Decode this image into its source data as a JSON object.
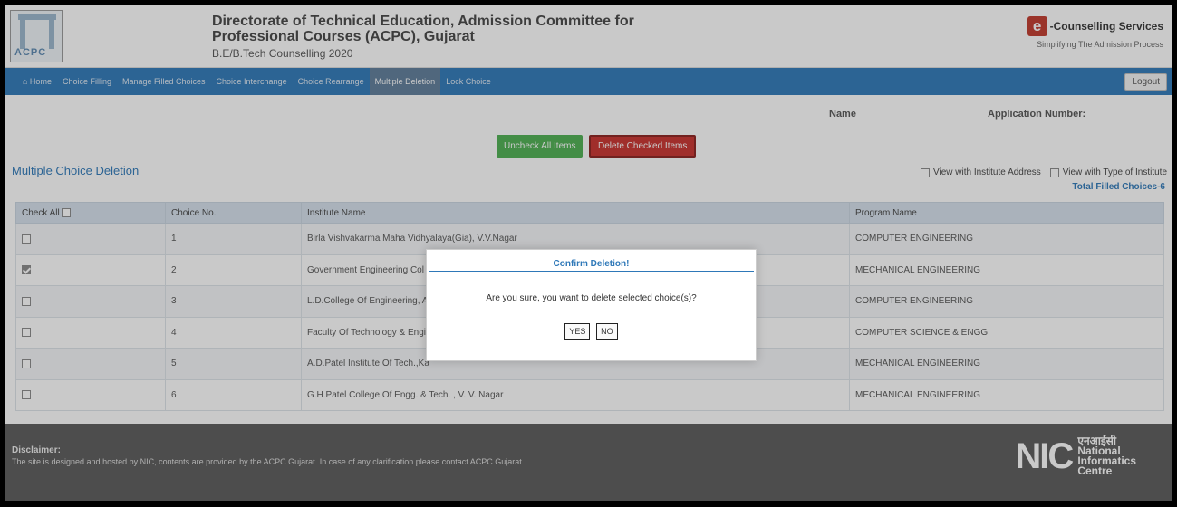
{
  "header": {
    "title_line1": "Directorate of Technical Education, Admission Committee for",
    "title_line2": "Professional Courses (ACPC), Gujarat",
    "subtitle": "B.E/B.Tech Counselling 2020",
    "logo_text": "ACPC",
    "brand_icon": "e",
    "brand_name": "-Counselling Services",
    "brand_tagline": "Simplifying The Admission Process"
  },
  "nav": {
    "items": [
      "⌂ Home",
      "Choice Filling",
      "Manage Filled Choices",
      "Choice Interchange",
      "Choice Rearrange",
      "Multiple Deletion",
      "Lock Choice"
    ],
    "active": "Multiple Deletion",
    "logout": "Logout"
  },
  "info": {
    "name_label": "Name",
    "app_label": "Application Number:"
  },
  "actions": {
    "uncheck": "Uncheck All Items",
    "delete": "Delete Checked Items"
  },
  "section": {
    "title": "Multiple Choice Deletion",
    "view_address": "View with Institute Address",
    "view_type": "View with Type of Institute",
    "total": "Total Filled Choices-6"
  },
  "table": {
    "headers": [
      "Check All",
      "Choice No.",
      "Institute Name",
      "Program Name"
    ],
    "rows": [
      {
        "checked": false,
        "no": "1",
        "institute": "Birla Vishvakarma Maha Vidhyalaya(Gia), V.V.Nagar",
        "program": "COMPUTER ENGINEERING"
      },
      {
        "checked": true,
        "no": "2",
        "institute": "Government Engineering Col",
        "program": "MECHANICAL ENGINEERING"
      },
      {
        "checked": false,
        "no": "3",
        "institute": "L.D.College Of Engineering, Al",
        "program": "COMPUTER ENGINEERING"
      },
      {
        "checked": false,
        "no": "4",
        "institute": "Faculty Of Technology & Engi",
        "program": "COMPUTER SCIENCE & ENGG"
      },
      {
        "checked": false,
        "no": "5",
        "institute": "A.D.Patel Institute Of Tech.,Ka",
        "program": "MECHANICAL ENGINEERING"
      },
      {
        "checked": false,
        "no": "6",
        "institute": "G.H.Patel College Of Engg. & Tech. , V. V. Nagar",
        "program": "MECHANICAL ENGINEERING"
      }
    ]
  },
  "footer": {
    "disclaimer_title": "Disclaimer:",
    "disclaimer_text": "The site is designed and hosted by NIC, contents are provided by the ACPC Gujarat. In case of any clarification please contact ACPC Gujarat.",
    "nic_mark": "NIC",
    "nic_hindi": "एनआईसी",
    "nic_en1": "National",
    "nic_en2": "Informatics",
    "nic_en3": "Centre"
  },
  "modal": {
    "title": "Confirm Deletion!",
    "question": "Are you sure, you want to delete selected choice(s)?",
    "yes": "YES",
    "no": "NO"
  }
}
